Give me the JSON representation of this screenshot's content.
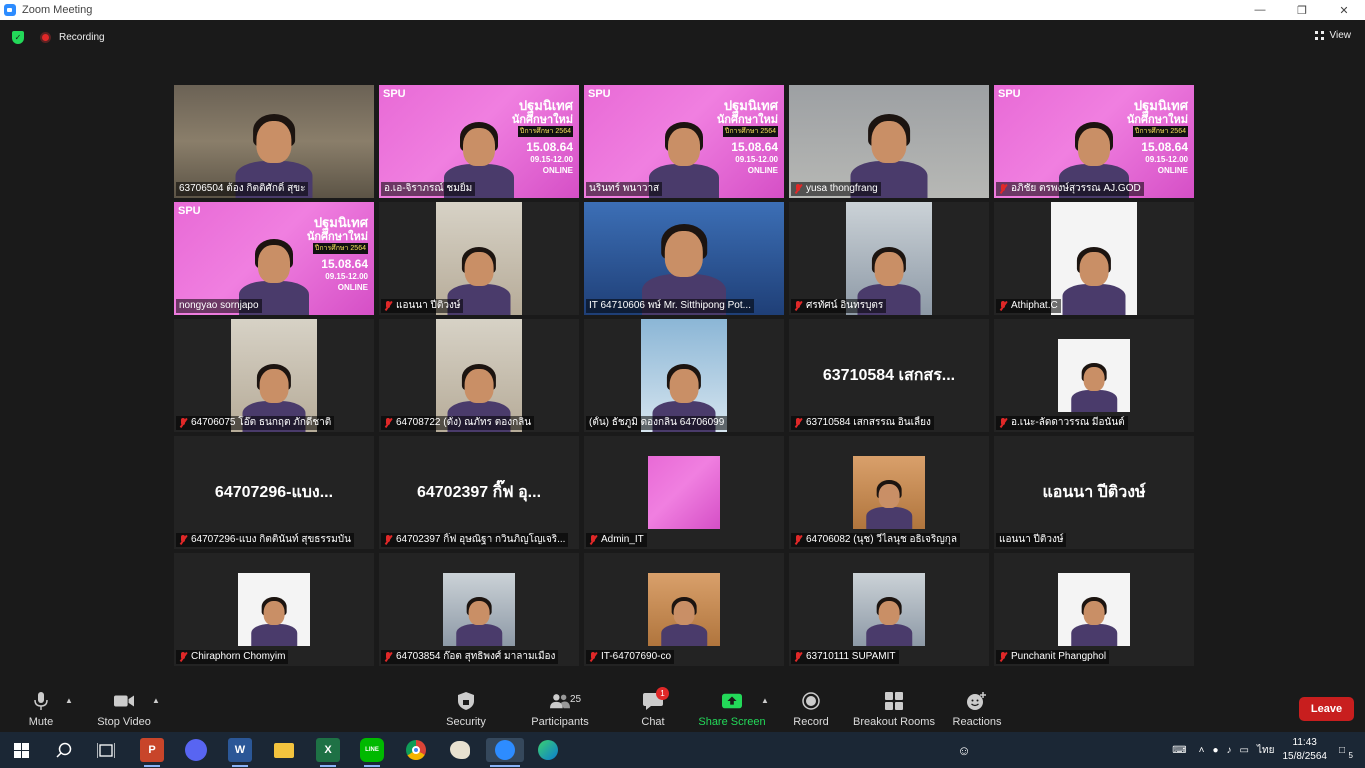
{
  "window": {
    "title": "Zoom Meeting"
  },
  "topbar": {
    "recording_label": "Recording",
    "view_label": "View"
  },
  "tiles": [
    {
      "name": "63706504 ต้อง กิตติศักดิ์ สุขะ",
      "muted": false,
      "kind": "video",
      "bg": "bg-room"
    },
    {
      "name": "อ.เอ-จิราภรณ์ ชมยิ้ม",
      "muted": false,
      "kind": "spu"
    },
    {
      "name": "นรินทร์ พนาวาส",
      "muted": false,
      "kind": "spu"
    },
    {
      "name": "yusa thongfrang",
      "muted": true,
      "kind": "video",
      "bg": "bg-grey"
    },
    {
      "name": "อภิชัย ตรพงษ์สุวรรณ AJ.GOD",
      "muted": true,
      "kind": "spu"
    },
    {
      "name": "nongyao sornjapo",
      "muted": false,
      "kind": "spu",
      "active": true
    },
    {
      "name": "แอนนา ปีติวงษ์",
      "muted": true,
      "kind": "video-narrow",
      "bg": "bg-home"
    },
    {
      "name": "IT 64710606 พษ์ Mr. Sitthipong Pot...",
      "muted": false,
      "kind": "video-wide",
      "bg": "bg-blue"
    },
    {
      "name": "ศรทัศน์ อินทรบุตร",
      "muted": true,
      "kind": "video-narrow",
      "bg": "bg-office"
    },
    {
      "name": "Athiphat.C",
      "muted": true,
      "kind": "video-narrow",
      "bg": "bg-white"
    },
    {
      "name": "64706075 โอ๊ต ธนกฤต ภักดีชาติ",
      "muted": true,
      "kind": "video-narrow",
      "bg": "bg-home"
    },
    {
      "name": "64708722 (ตั๋ง) ณภัทร ตองกลิ่น",
      "muted": true,
      "kind": "video-narrow",
      "bg": "bg-home"
    },
    {
      "name": "(ตั้น) ธัชภูมิ ดองกลิ่น 64706099",
      "muted": false,
      "kind": "video-narrow",
      "bg": "bg-snow"
    },
    {
      "name": "63710584 เสกสรรณ อินเลี้ยง",
      "muted": true,
      "kind": "name",
      "big": "63710584 เสกสร..."
    },
    {
      "name": "อ.เนะ-ลัดดาวรรณ มีอนันต์",
      "muted": true,
      "kind": "avatar",
      "bg": "bg-white"
    },
    {
      "name": "64707296-แบง กิตตินันท์ สุขธรรมบัน",
      "muted": true,
      "kind": "name",
      "big": "64707296-แบง..."
    },
    {
      "name": "64702397 กิ๊ฟ อุษณิฐา กวินภิญโญเจริ...",
      "muted": true,
      "kind": "name",
      "big": "64702397 กิ๊ฟ อุ..."
    },
    {
      "name": "Admin_IT",
      "muted": true,
      "kind": "avatar-spu"
    },
    {
      "name": "64706082 (นุช) วีไลนุช อธิเจริญกุล",
      "muted": true,
      "kind": "avatar",
      "bg": "bg-warm"
    },
    {
      "name": "แอนนา ปีติวงษ์",
      "muted": false,
      "kind": "name",
      "big": "แอนนา ปีติวงษ์"
    },
    {
      "name": "Chiraphorn Chomyim",
      "muted": true,
      "kind": "avatar",
      "bg": "bg-white"
    },
    {
      "name": "64703854 ก๊อต สุทธิพงศ์ มาลามเมือง",
      "muted": true,
      "kind": "avatar",
      "bg": "bg-office"
    },
    {
      "name": "IT-64707690-co",
      "muted": true,
      "kind": "avatar",
      "bg": "bg-warm"
    },
    {
      "name": "63710111 SUPAMIT",
      "muted": true,
      "kind": "avatar",
      "bg": "bg-office"
    },
    {
      "name": "Punchanit Phangphol",
      "muted": true,
      "kind": "avatar",
      "bg": "bg-white"
    }
  ],
  "spu_banner": {
    "logo": "SPU",
    "line1": "ปฐมนิเทศ",
    "line2": "นักศึกษาใหม่",
    "line3": "ปีการศึกษา 2564",
    "date": "15.08.64",
    "time": "09.15-12.00",
    "mode": "ONLINE"
  },
  "toolbar": {
    "mute": "Mute",
    "stop_video": "Stop Video",
    "security": "Security",
    "participants": "Participants",
    "participants_count": "25",
    "chat": "Chat",
    "chat_badge": "1",
    "share_screen": "Share Screen",
    "record": "Record",
    "breakout_rooms": "Breakout Rooms",
    "reactions": "Reactions",
    "leave": "Leave"
  },
  "taskbar": {
    "language": "ไทย",
    "time": "11:43",
    "date": "15/8/2564",
    "notifications": "5"
  },
  "colors": {
    "accent_green": "#23d959",
    "leave_red": "#c81e1e",
    "active_speaker": "#f3e87a",
    "spu_pink": "#e86ad6"
  }
}
